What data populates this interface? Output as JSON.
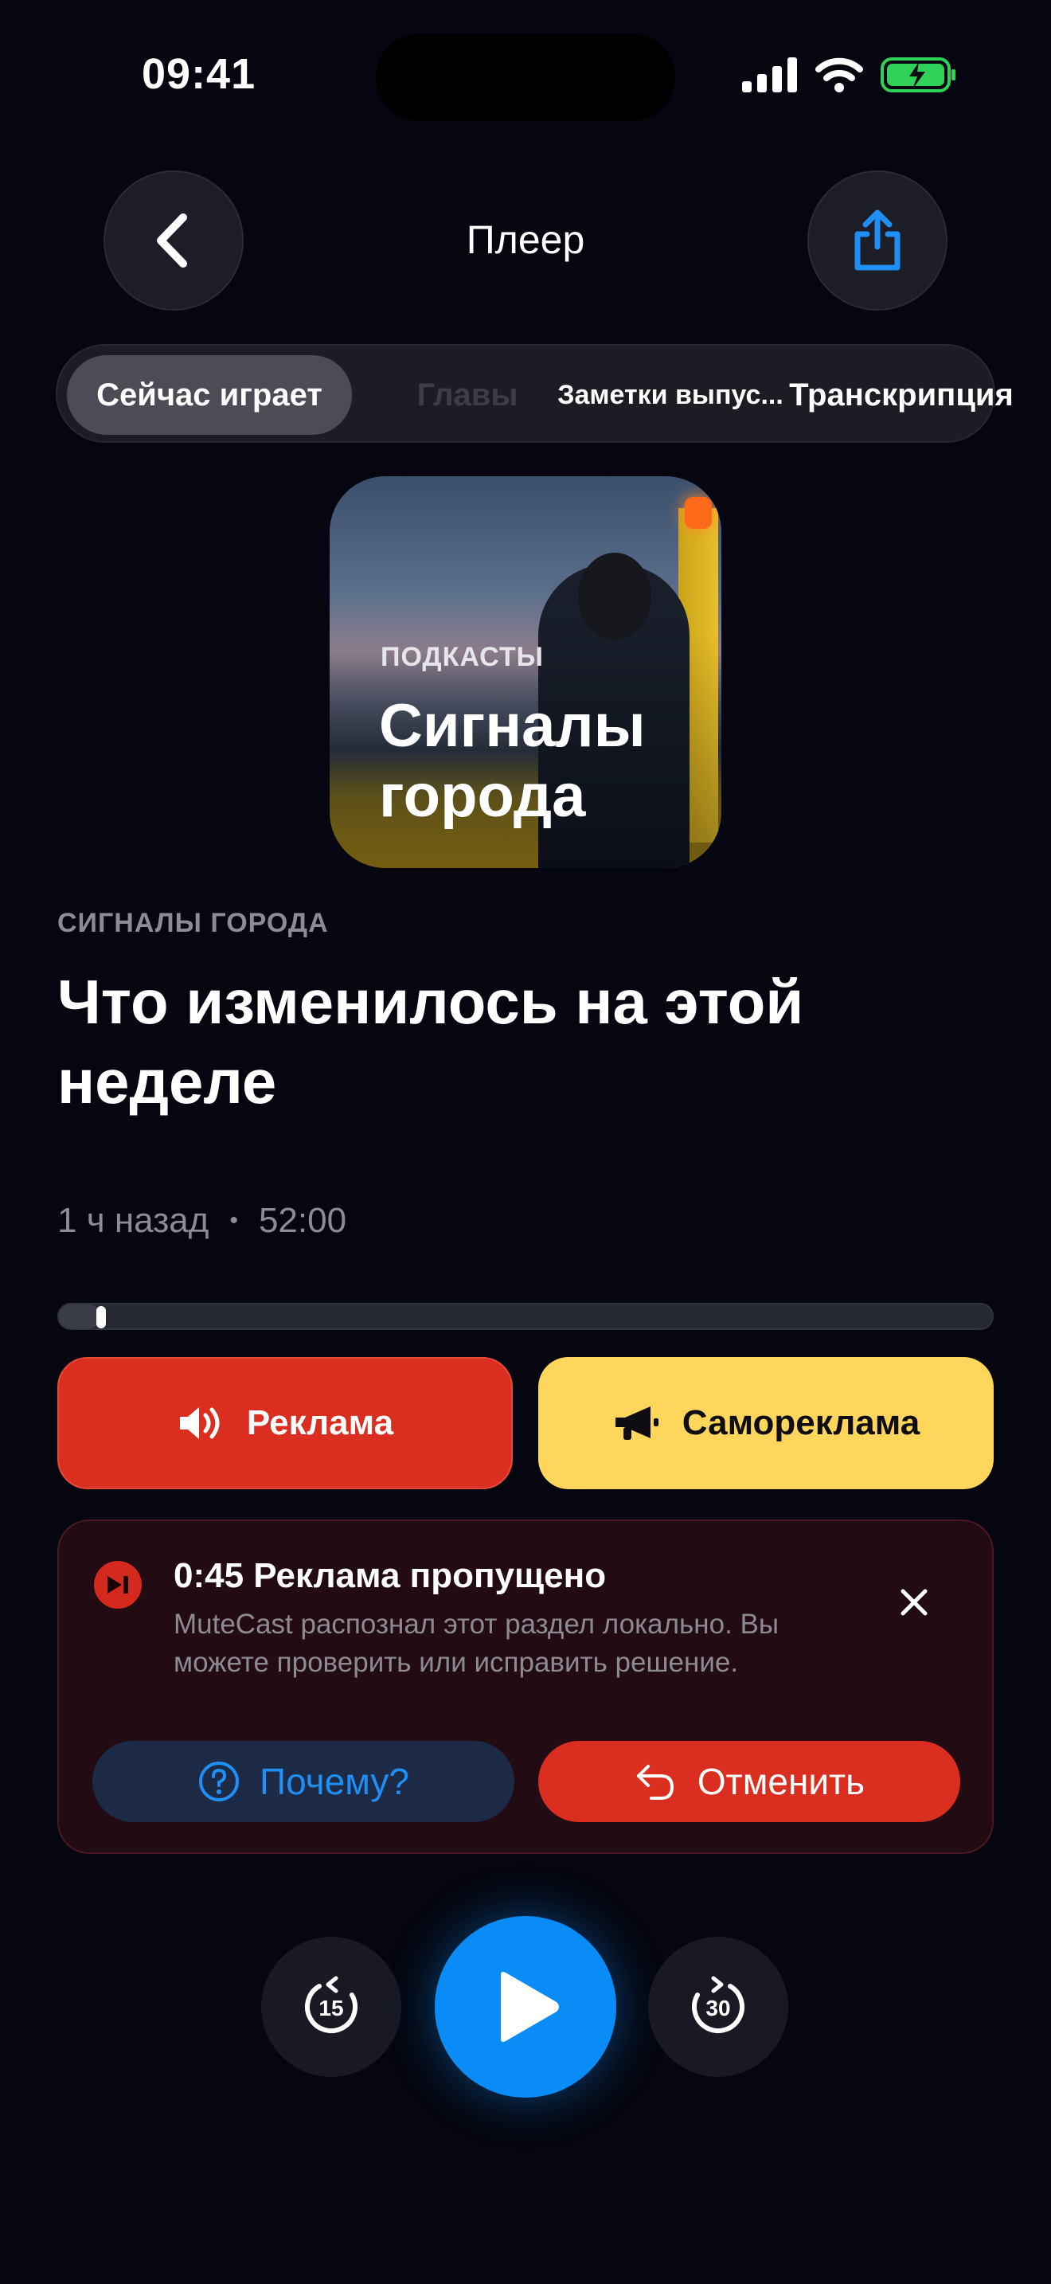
{
  "status_bar": {
    "time": "09:41",
    "icons": [
      "signal-icon",
      "wifi-icon",
      "battery-charging-icon"
    ]
  },
  "header": {
    "title": "Плеер",
    "back_icon": "chevron-left-icon",
    "share_icon": "share-icon"
  },
  "tabs": [
    {
      "label": "Сейчас играет",
      "active": true
    },
    {
      "label": "Главы",
      "active": false
    },
    {
      "label": "Заметки выпус...",
      "active": false
    },
    {
      "label": "Транскрипция",
      "active": false
    }
  ],
  "artwork": {
    "tag": "ПОДКАСТЫ",
    "title": "Сигналы города"
  },
  "episode": {
    "show": "СИГНАЛЫ ГОРОДА",
    "title": "Что изменилось на этой неделе",
    "published": "1 ч назад",
    "separator": "•",
    "duration": "52:00",
    "progress_fraction": 0.045
  },
  "categories": {
    "ad_label": "Реклама",
    "self_promo_label": "Самореклама"
  },
  "skip_notice": {
    "title": "0:45 Реклама пропущено",
    "text": "MuteCast распознал этот раздел локально. Вы можете проверить или исправить решение.",
    "why_label": "Почему?",
    "undo_label": "Отменить"
  },
  "controls": {
    "rewind_seconds": "15",
    "forward_seconds": "30"
  },
  "colors": {
    "background": "#05060f",
    "accent_blue": "#0a8cf7",
    "ad_red": "#d92e20",
    "self_promo_yellow": "#ffd65c"
  }
}
